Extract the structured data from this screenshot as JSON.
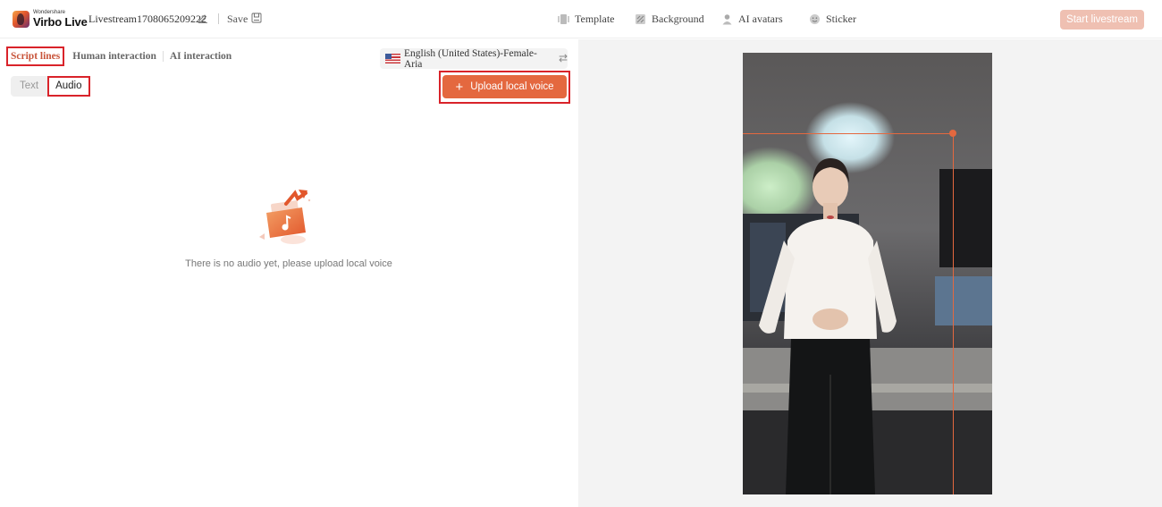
{
  "app": {
    "brand_small": "Wondershare",
    "brand_big": "Virbo Live",
    "project_name": "Livestream1708065209222",
    "save_label": "Save"
  },
  "toolbar": {
    "tools": [
      {
        "label": "Template",
        "icon": "template-icon"
      },
      {
        "label": "Background",
        "icon": "background-icon"
      },
      {
        "label": "AI avatars",
        "icon": "avatar-icon"
      },
      {
        "label": "Sticker",
        "icon": "sticker-icon"
      }
    ],
    "start_label": "Start livestream"
  },
  "left": {
    "tabs": [
      {
        "label": "Script lines",
        "active": true
      },
      {
        "label": "Human interaction",
        "active": false
      },
      {
        "label": "AI interaction",
        "active": false
      }
    ],
    "subtabs": [
      {
        "label": "Text",
        "active": false
      },
      {
        "label": "Audio",
        "active": true
      }
    ],
    "voice": "English (United States)-Female-Aria",
    "upload_label": "Upload local voice",
    "empty_message": "There is no audio yet, please upload local voice"
  },
  "colors": {
    "accent": "#e4683f",
    "highlight_box": "#d9232a",
    "start_disabled": "#efc0b2"
  }
}
